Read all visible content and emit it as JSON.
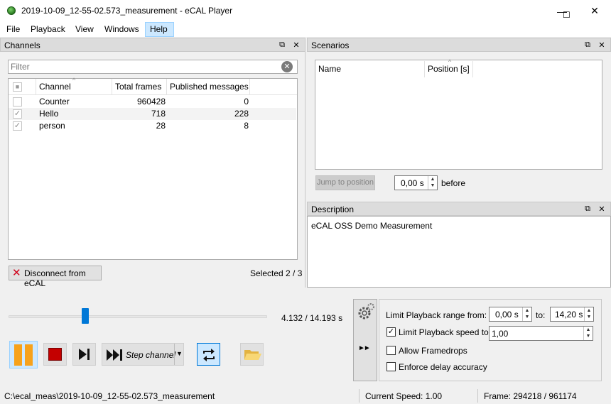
{
  "window": {
    "title": "2019-10-09_12-55-02.573_measurement - eCAL Player",
    "minimize": "—",
    "maximize": "☐",
    "close": "✕"
  },
  "menu": [
    "File",
    "Playback",
    "View",
    "Windows",
    "Help"
  ],
  "channels": {
    "title": "Channels",
    "filter_placeholder": "Filter",
    "columns": [
      "Channel",
      "Total frames",
      "Published messages"
    ],
    "rows": [
      {
        "checked": false,
        "channel": "Counter",
        "total_frames": "960428",
        "published": "0"
      },
      {
        "checked": true,
        "channel": "Hello",
        "total_frames": "718",
        "published": "228"
      },
      {
        "checked": true,
        "channel": "person",
        "total_frames": "28",
        "published": "8"
      }
    ],
    "disconnect_label": "Disconnect from eCAL",
    "selected_text": "Selected 2 / 3"
  },
  "scenarios": {
    "title": "Scenarios",
    "columns": [
      "Name",
      "Position [s]"
    ],
    "jump_label": "Jump to position",
    "position_value": "0,00 s",
    "before_label": "before"
  },
  "description": {
    "title": "Description",
    "text": "eCAL OSS Demo Measurement"
  },
  "player": {
    "time_text": "4.132 / 14.193 s",
    "slider_fraction": 0.291,
    "step_channel_label": "Step channel"
  },
  "settings": {
    "limit_range_label": "Limit Playback range from:",
    "range_from": "0,00 s",
    "to_label": "to:",
    "range_to": "14,20 s",
    "limit_speed_label": "Limit Playback speed to:",
    "limit_speed_checked": true,
    "speed_value": "1,00",
    "allow_framedrops_label": "Allow Framedrops",
    "allow_framedrops_checked": false,
    "enforce_delay_label": "Enforce delay accuracy",
    "enforce_delay_checked": false
  },
  "status": {
    "path": "C:\\ecal_meas\\2019-10-09_12-55-02.573_measurement",
    "speed": "Current Speed: 1.00",
    "frame": "Frame: 294218 / 961174"
  },
  "colors": {
    "accent": "#0078d7",
    "pause_orange": "#f7a21b",
    "stop_red": "#c40000",
    "selection_blue": "#cce8ff"
  }
}
